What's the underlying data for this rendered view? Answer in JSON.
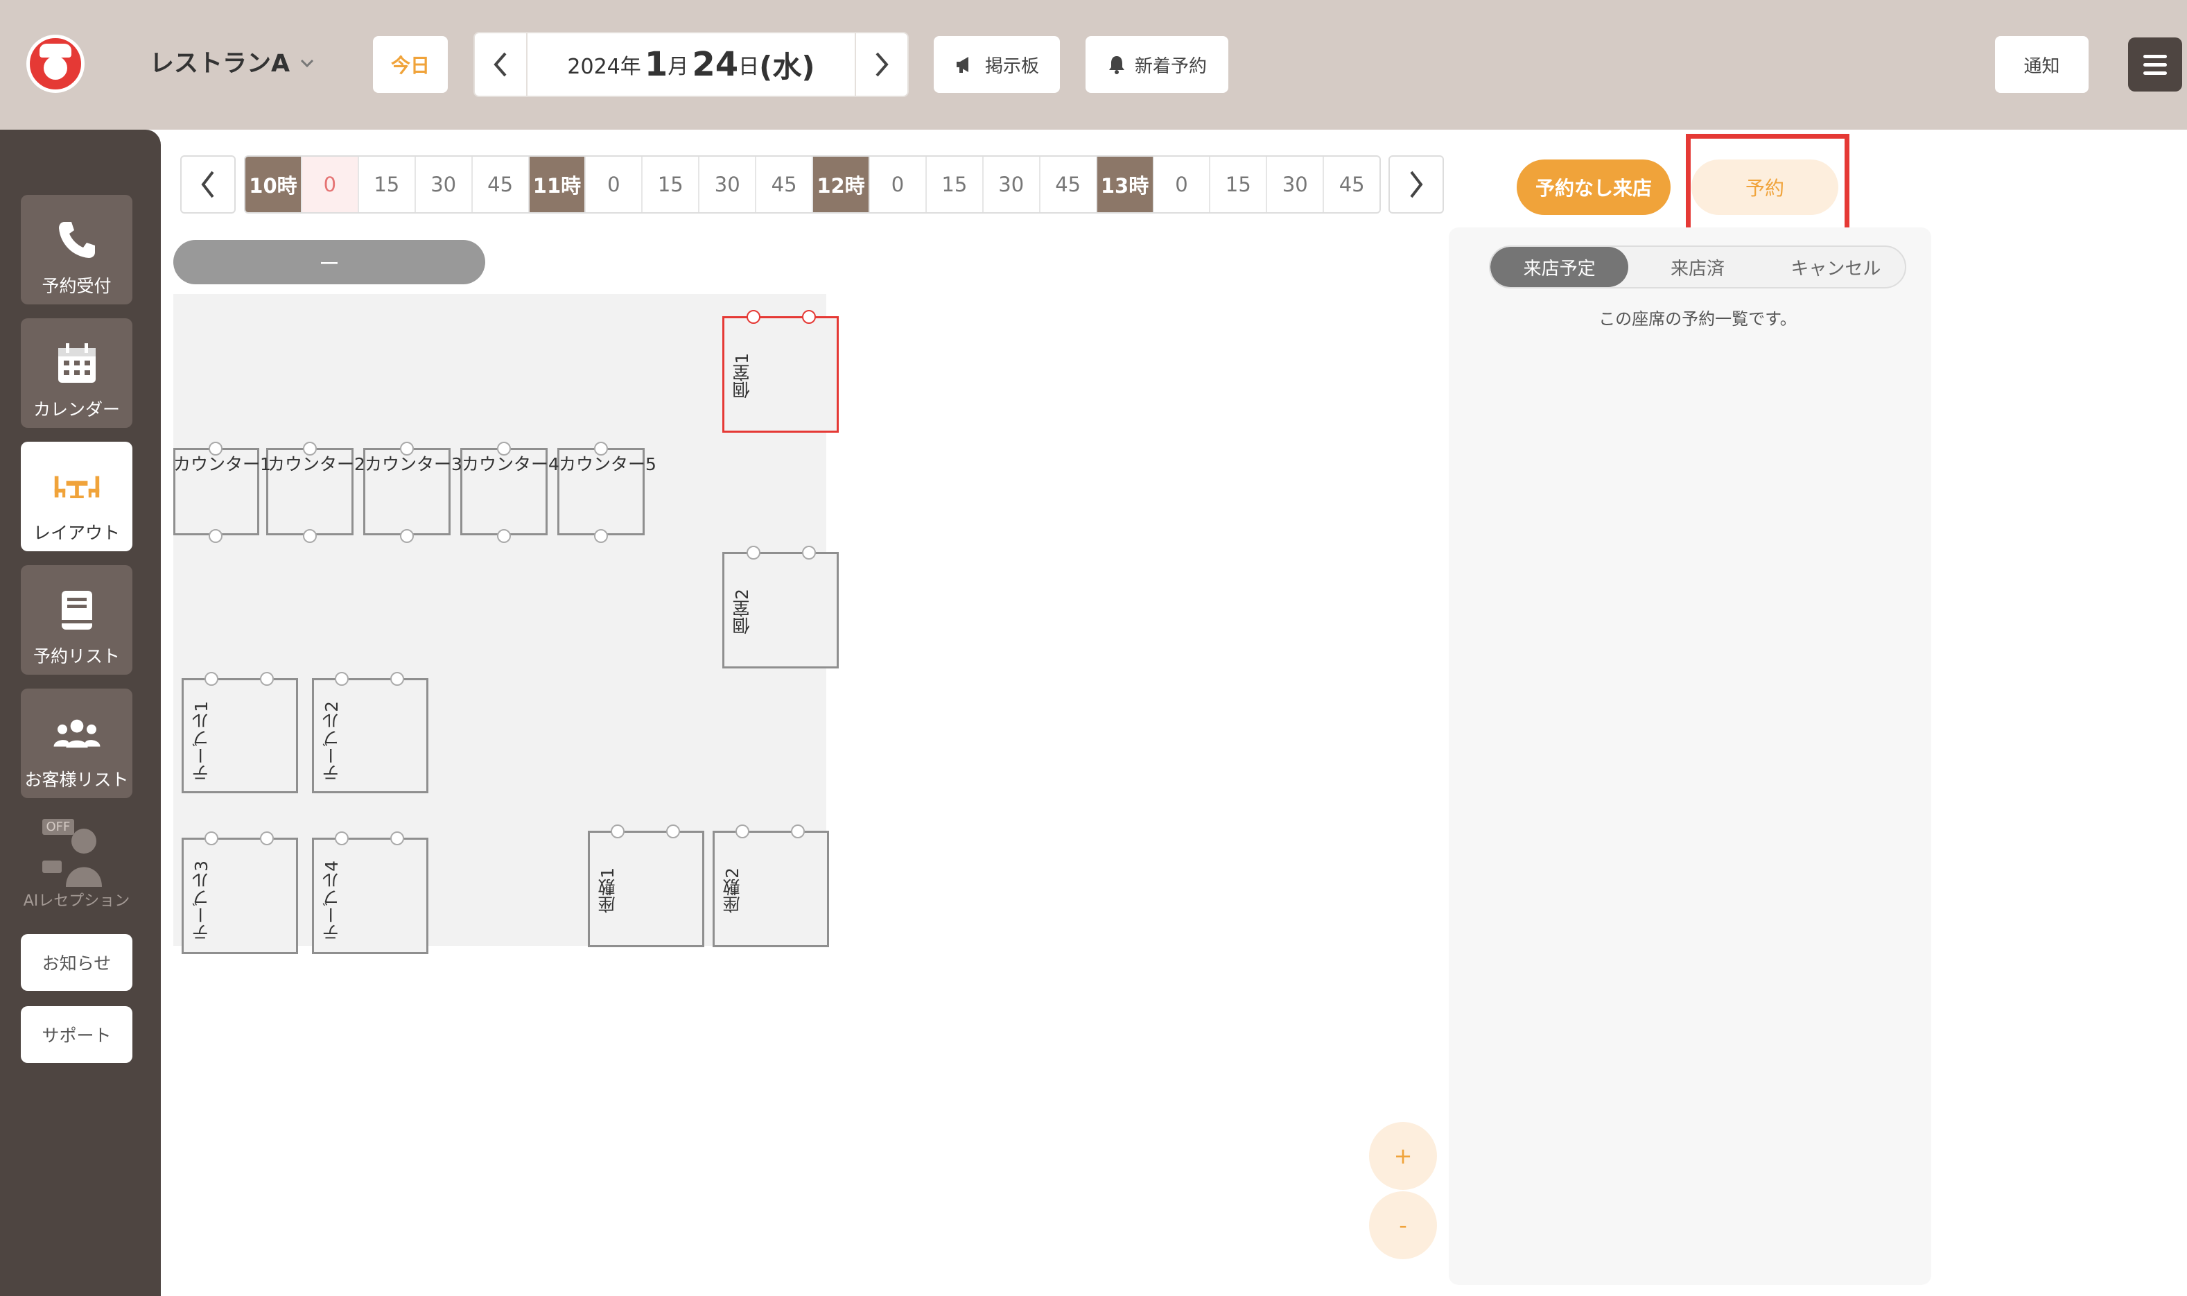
{
  "header": {
    "restaurant_name": "レストランA",
    "today_label": "今日",
    "date": {
      "year": "2024年",
      "month_num": "1",
      "month_unit": "月",
      "day_num": "24",
      "day_unit": "日",
      "weekday": "(水)"
    },
    "board_label": "掲示板",
    "new_reservation_label": "新着予約",
    "notification_label": "通知"
  },
  "sidebar": {
    "items": [
      {
        "label": "予約受付",
        "icon": "phone-icon"
      },
      {
        "label": "カレンダー",
        "icon": "calendar-icon"
      },
      {
        "label": "レイアウト",
        "icon": "layout-icon",
        "active": true
      },
      {
        "label": "予約リスト",
        "icon": "book-icon"
      },
      {
        "label": "お客様リスト",
        "icon": "users-icon"
      }
    ],
    "ai_reception": {
      "label": "AIレセプション",
      "badge": "OFF"
    },
    "news_label": "お知らせ",
    "support_label": "サポート"
  },
  "timeline": {
    "cells": [
      "10時",
      "0",
      "15",
      "30",
      "45",
      "11時",
      "0",
      "15",
      "30",
      "45",
      "12時",
      "0",
      "15",
      "30",
      "45",
      "13時",
      "0",
      "15",
      "30",
      "45"
    ],
    "hour_indices": [
      0,
      5,
      10,
      15
    ],
    "current_index": 1
  },
  "slider_label": "ー",
  "seats": {
    "private1": "個室1",
    "private2": "個室2",
    "counter1": "カウンター1",
    "counter2": "カウンター2",
    "counter3": "カウンター3",
    "counter4": "カウンター4",
    "counter5": "カウンター5",
    "table1": "テーブル1",
    "table2": "テーブル2",
    "table3": "テーブル3",
    "table4": "テーブル4",
    "zashiki1": "座敷1",
    "zashiki2": "座敷2"
  },
  "zoom": {
    "in_label": "+",
    "out_label": "-"
  },
  "right_panel": {
    "walkin_label": "予約なし来店",
    "reserve_label": "予約",
    "tabs": [
      "来店予定",
      "来店済",
      "キャンセル"
    ],
    "active_tab": 0,
    "message": "この座席の予約一覧です。"
  },
  "colors": {
    "accent": "#f0a33a",
    "sidebar_bg": "#4e4541",
    "header_bg": "#d5cbc5",
    "hour_cell": "#8c7768",
    "highlight": "#e53935"
  }
}
